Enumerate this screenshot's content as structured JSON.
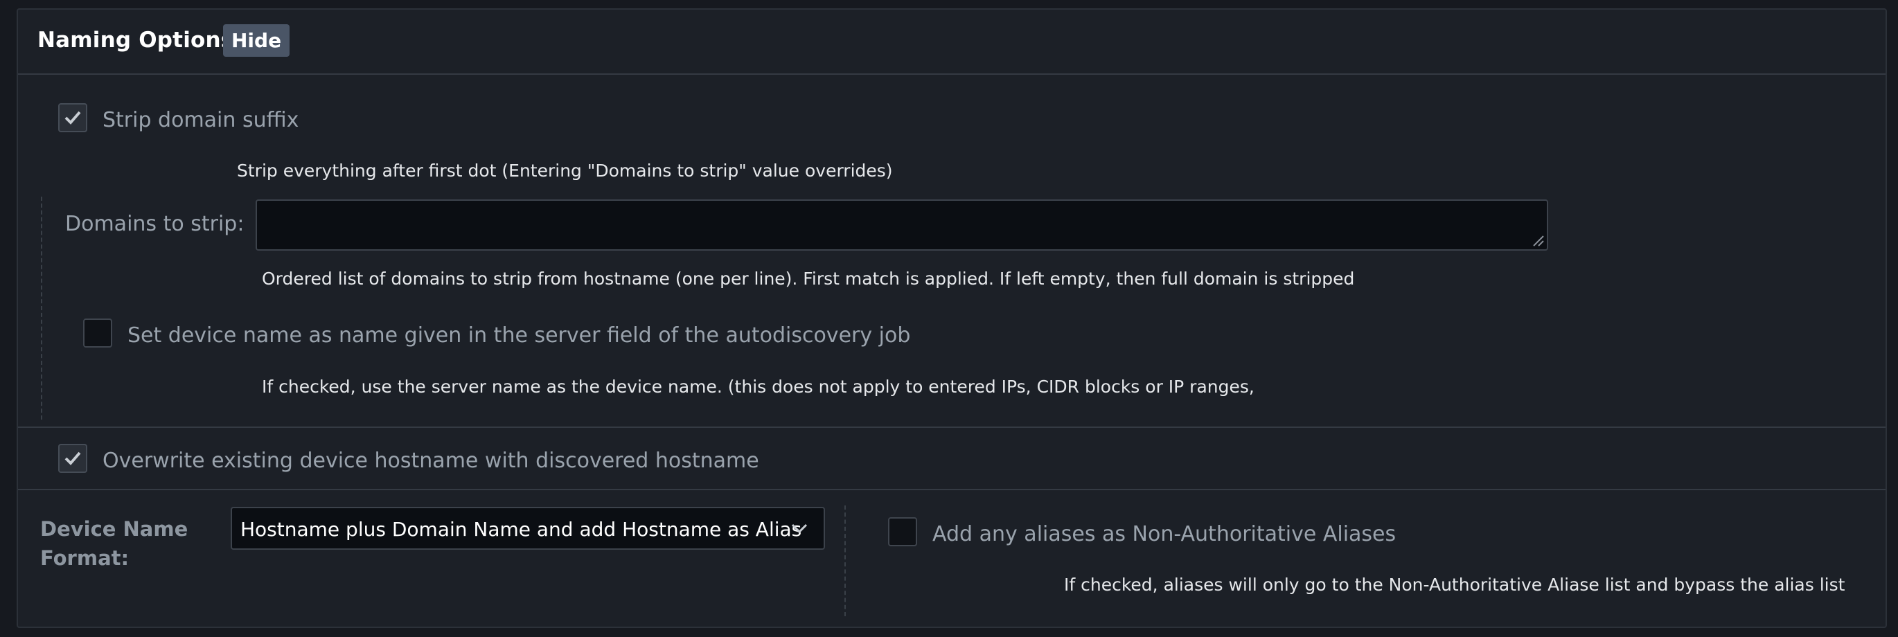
{
  "header": {
    "title": "Naming Options",
    "hide_label": "Hide"
  },
  "strip_domain": {
    "label": "Strip domain suffix",
    "checked": true,
    "help": "Strip everything after first dot (Entering \"Domains to strip\" value overrides)"
  },
  "domains_to_strip": {
    "label": "Domains to strip:",
    "value": "",
    "help": "Ordered list of domains to strip from hostname (one per line). First match is applied. If left empty, then full domain is stripped"
  },
  "server_name": {
    "label": "Set device name as name given in the server field of the autodiscovery job",
    "checked": false,
    "help": "If checked, use the server name as the device name. (this does not apply to entered IPs, CIDR blocks or IP ranges,"
  },
  "overwrite": {
    "label": "Overwrite existing device hostname with discovered hostname",
    "checked": true
  },
  "device_name_format": {
    "label_line1": "Device Name",
    "label_line2": "Format:",
    "selected": "Hostname plus Domain Name and add Hostname as Alias"
  },
  "non_auth_aliases": {
    "label": "Add any aliases as Non-Authoritative Aliases",
    "checked": false,
    "help": "If checked, aliases will only go to the Non-Authoritative Aliase list and bypass the alias list"
  },
  "icons": {
    "checkmark": "checkmark-icon",
    "chevron": "chevron-down-icon",
    "resize": "resize-handle-icon"
  }
}
